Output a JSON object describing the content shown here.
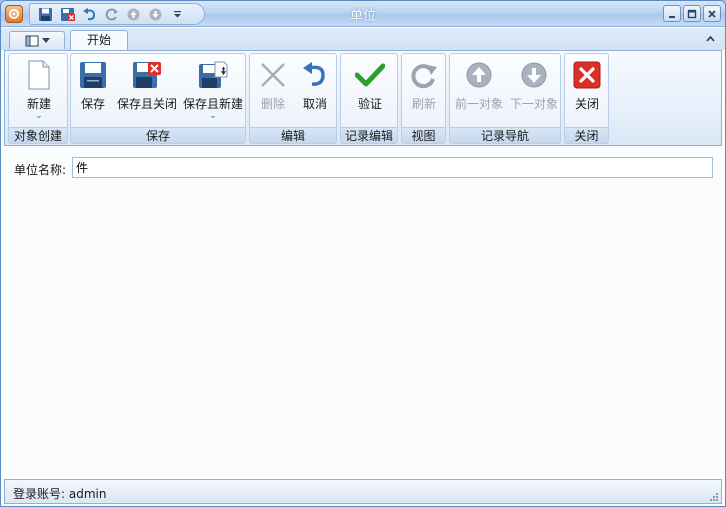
{
  "window": {
    "title": "单位"
  },
  "ribbon": {
    "menu_icon": "panel-menu-icon",
    "tabs": [
      {
        "label": "开始",
        "selected": true
      }
    ],
    "groups": [
      {
        "label": "对象创建",
        "buttons": [
          {
            "label": "新建",
            "icon": "new-document-icon",
            "enabled": true,
            "dropdown": true
          }
        ]
      },
      {
        "label": "保存",
        "buttons": [
          {
            "label": "保存",
            "icon": "save-icon",
            "enabled": true
          },
          {
            "label": "保存且关闭",
            "icon": "save-close-icon",
            "enabled": true
          },
          {
            "label": "保存且新建",
            "icon": "save-new-icon",
            "enabled": true,
            "dropdown": true
          }
        ]
      },
      {
        "label": "编辑",
        "buttons": [
          {
            "label": "删除",
            "icon": "delete-icon",
            "enabled": false
          },
          {
            "label": "取消",
            "icon": "undo-icon",
            "enabled": true
          }
        ]
      },
      {
        "label": "记录编辑",
        "buttons": [
          {
            "label": "验证",
            "icon": "checkmark-icon",
            "enabled": true
          }
        ]
      },
      {
        "label": "视图",
        "buttons": [
          {
            "label": "刷新",
            "icon": "refresh-icon",
            "enabled": false
          }
        ]
      },
      {
        "label": "记录导航",
        "buttons": [
          {
            "label": "前一对象",
            "icon": "arrow-up-icon",
            "enabled": false
          },
          {
            "label": "下一对象",
            "icon": "arrow-down-icon",
            "enabled": false
          }
        ]
      },
      {
        "label": "关闭",
        "buttons": [
          {
            "label": "关闭",
            "icon": "close-red-icon",
            "enabled": true
          }
        ]
      }
    ]
  },
  "form": {
    "unit_name_label": "单位名称:",
    "unit_name_value": "件"
  },
  "status": {
    "text": "登录账号: admin"
  },
  "colors": {
    "accent": "#5b8bc2",
    "ribbon_bg": "#e4eefa",
    "close_red": "#d9302a",
    "check_green": "#2f9e2f"
  }
}
